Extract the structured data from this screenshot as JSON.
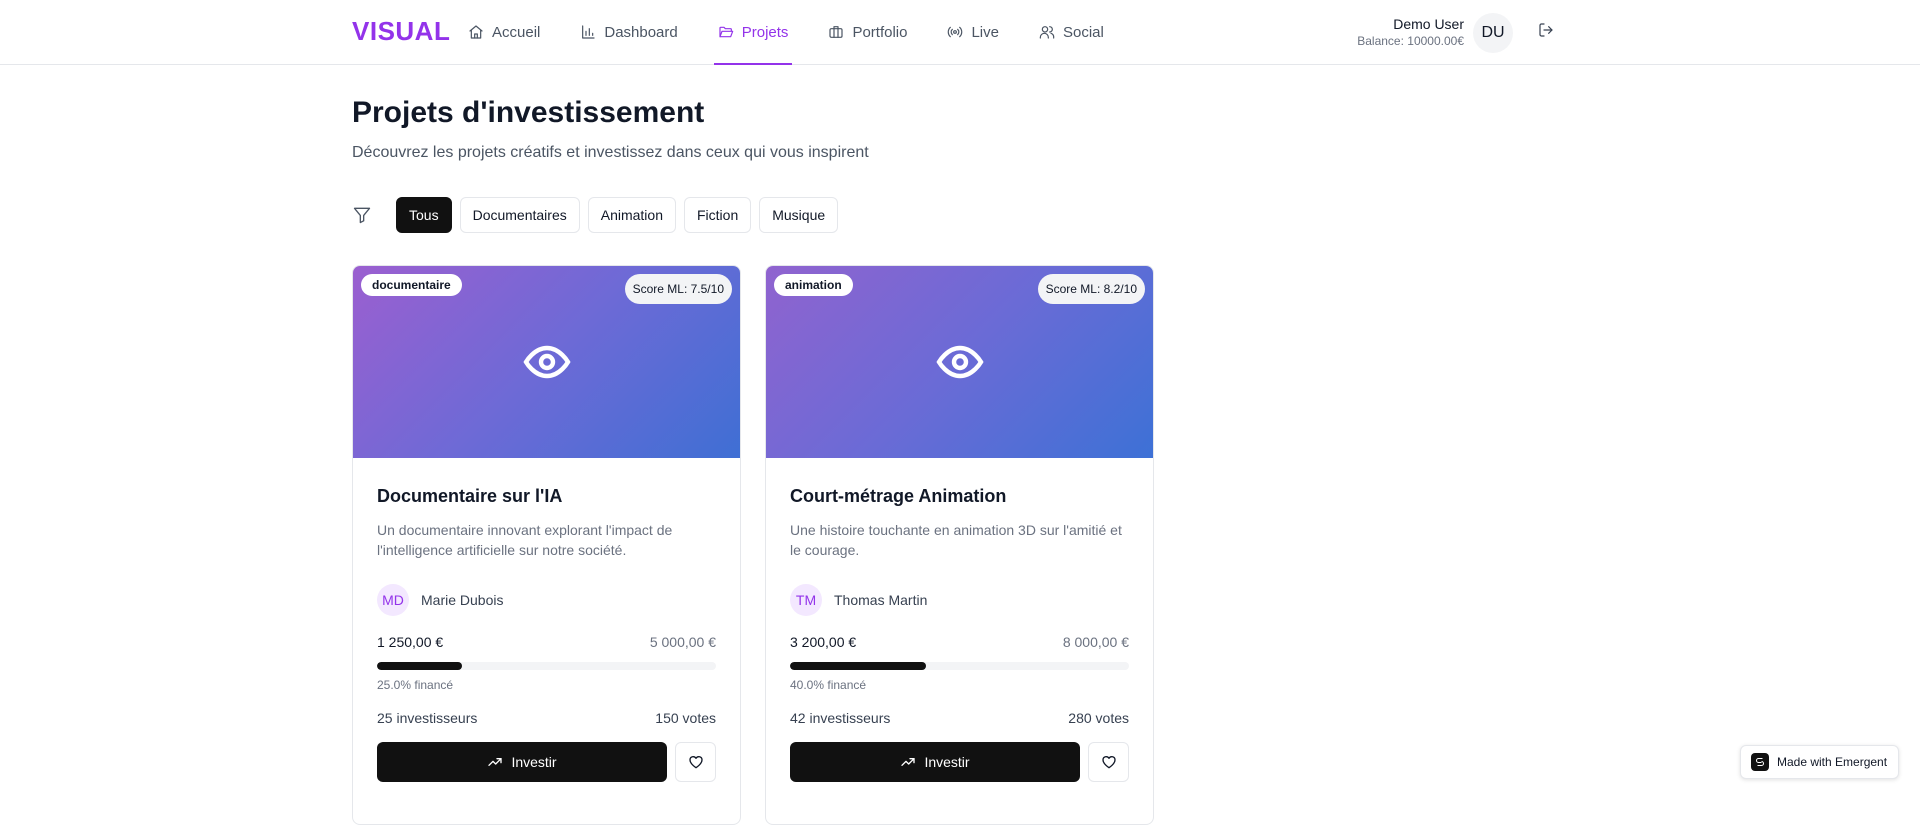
{
  "app": {
    "logo": "VISUAL"
  },
  "nav": {
    "items": [
      {
        "label": "Accueil",
        "icon": "home-icon",
        "active": false
      },
      {
        "label": "Dashboard",
        "icon": "bar-chart-icon",
        "active": false
      },
      {
        "label": "Projets",
        "icon": "folder-open-icon",
        "active": true
      },
      {
        "label": "Portfolio",
        "icon": "briefcase-icon",
        "active": false
      },
      {
        "label": "Live",
        "icon": "radio-icon",
        "active": false
      },
      {
        "label": "Social",
        "icon": "users-icon",
        "active": false
      }
    ]
  },
  "user": {
    "name": "Demo User",
    "balance": "Balance: 10000.00€",
    "initials": "DU"
  },
  "page": {
    "title": "Projets d'investissement",
    "subtitle": "Découvrez les projets créatifs et investissez dans ceux qui vous inspirent"
  },
  "filters": {
    "items": [
      "Tous",
      "Documentaires",
      "Animation",
      "Fiction",
      "Musique"
    ],
    "selected": "Tous"
  },
  "projects": [
    {
      "category": "documentaire",
      "score": "Score ML: 7.5/10",
      "title": "Documentaire sur l'IA",
      "description": "Un documentaire innovant explorant l'impact de l'intelligence artificielle sur notre société.",
      "creator_initials": "MD",
      "creator_name": "Marie Dubois",
      "raised": "1 250,00 €",
      "goal": "5 000,00 €",
      "funded_fraction": 0.25,
      "funded_label": "25.0% financé",
      "investors": "25 investisseurs",
      "votes": "150 votes",
      "invest_label": "Investir"
    },
    {
      "category": "animation",
      "score": "Score ML: 8.2/10",
      "title": "Court-métrage Animation",
      "description": "Une histoire touchante en animation 3D sur l'amitié et le courage.",
      "creator_initials": "TM",
      "creator_name": "Thomas Martin",
      "raised": "3 200,00 €",
      "goal": "8 000,00 €",
      "funded_fraction": 0.4,
      "funded_label": "40.0% financé",
      "investors": "42 investisseurs",
      "votes": "280 votes",
      "invest_label": "Investir"
    }
  ],
  "footer_badge": {
    "label": "Made with Emergent"
  },
  "colors": {
    "accent": "#9333ea",
    "primary_button": "#111111"
  }
}
